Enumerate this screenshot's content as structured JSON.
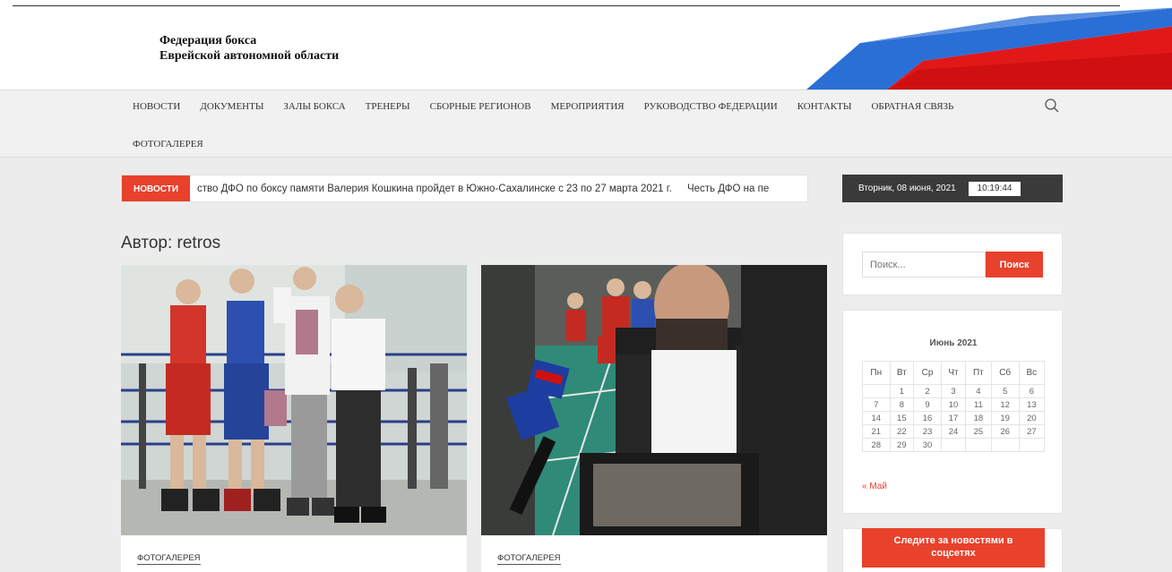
{
  "header": {
    "logo_line1": "Федерация бокса",
    "logo_line2": "Еврейской автономной области"
  },
  "nav": {
    "items": [
      "НОВОСТИ",
      "ДОКУМЕНТЫ",
      "ЗАЛЫ БОКСА",
      "ТРЕНЕРЫ",
      "СБОРНЫЕ РЕГИОНОВ",
      "МЕРОПРИЯТИЯ",
      "РУКОВОДСТВО ФЕДЕРАЦИИ",
      "КОНТАКТЫ",
      "ОБРАТНАЯ СВЯЗЬ",
      "ФОТОГАЛЕРЕЯ"
    ]
  },
  "ticker": {
    "label": "НОВОСТИ",
    "items": [
      "ство ДФО по боксу памяти Валерия Кошкина пройдет в Южно-Сахалинске с 23 по 27 марта 2021 г.",
      "Честь ДФО на пе"
    ]
  },
  "datebar": {
    "date": "Вторник, 08 июня, 2021",
    "time": "10:19:44"
  },
  "main": {
    "title": "Автор: retros",
    "cards": [
      {
        "category": "ФОТОГАЛЕРЕЯ"
      },
      {
        "category": "ФОТОГАЛЕРЕЯ"
      }
    ]
  },
  "sidebar": {
    "search": {
      "placeholder": "Поиск...",
      "button": "Поиск"
    },
    "calendar": {
      "caption": "Июнь 2021",
      "weekdays": [
        "Пн",
        "Вт",
        "Ср",
        "Чт",
        "Пт",
        "Сб",
        "Вс"
      ],
      "weeks": [
        [
          "",
          "1",
          "2",
          "3",
          "4",
          "5",
          "6"
        ],
        [
          "7",
          "8",
          "9",
          "10",
          "11",
          "12",
          "13"
        ],
        [
          "14",
          "15",
          "16",
          "17",
          "18",
          "19",
          "20"
        ],
        [
          "21",
          "22",
          "23",
          "24",
          "25",
          "26",
          "27"
        ],
        [
          "28",
          "29",
          "30",
          "",
          "",
          "",
          ""
        ]
      ],
      "prev": "« Май"
    },
    "social": {
      "line1": "Следите за новостями в",
      "line2": "соцсетях"
    }
  },
  "colors": {
    "accent": "#e8412c",
    "dark": "#3a3a3a"
  }
}
